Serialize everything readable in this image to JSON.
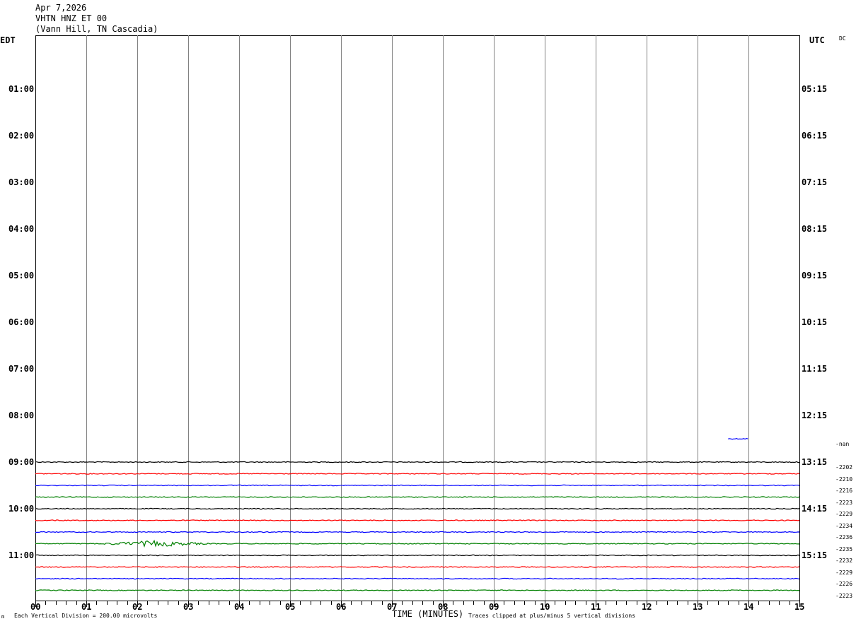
{
  "header": {
    "date": "Apr 7,2026",
    "station": "VHTN HNZ ET 00",
    "location": "(Vann Hill, TN Cascadia)"
  },
  "tz_left": "EDT",
  "tz_right": "UTC",
  "dc_label": "DC",
  "left_times": [
    "01:00",
    "02:00",
    "03:00",
    "04:00",
    "05:00",
    "06:00",
    "07:00",
    "08:00",
    "09:00",
    "10:00",
    "11:00"
  ],
  "right_times": [
    "05:15",
    "06:15",
    "07:15",
    "08:15",
    "09:15",
    "10:15",
    "11:15",
    "12:15",
    "13:15",
    "14:15",
    "15:15"
  ],
  "footer": {
    "division_note": "Each Vertical Division =  200.00 microvolts",
    "xlabel": "TIME (MINUTES)",
    "clip_note": "Traces clipped at plus/minus 5 vertical divisions",
    "corner_mark": "m"
  },
  "colors": {
    "black": "#000000",
    "red": "#ff0000",
    "blue": "#0000ff",
    "green": "#008000",
    "grid": "#808080"
  },
  "chart_data": {
    "type": "line",
    "title": "VHTN HNZ ET 00",
    "xlabel": "TIME (MINUTES)",
    "xlim": [
      0,
      15
    ],
    "x_ticks": [
      "00",
      "01",
      "02",
      "03",
      "04",
      "05",
      "06",
      "07",
      "08",
      "09",
      "10",
      "11",
      "12",
      "13",
      "14",
      "15"
    ],
    "y_axis": "hours, 15-minute traces per line",
    "traces": [
      {
        "start_edt": "08:30",
        "color": "blue",
        "dc_offset": "-nan",
        "span_min": [
          13.6,
          14.0
        ]
      },
      {
        "start_edt": "09:00",
        "color": "black",
        "dc_offset": "-2202"
      },
      {
        "start_edt": "09:15",
        "color": "red",
        "dc_offset": "-2210"
      },
      {
        "start_edt": "09:30",
        "color": "blue",
        "dc_offset": "-2216"
      },
      {
        "start_edt": "09:45",
        "color": "green",
        "dc_offset": "-2223"
      },
      {
        "start_edt": "10:00",
        "color": "black",
        "dc_offset": "-2229"
      },
      {
        "start_edt": "10:15",
        "color": "red",
        "dc_offset": "-2234"
      },
      {
        "start_edt": "10:30",
        "color": "blue",
        "dc_offset": "-2236"
      },
      {
        "start_edt": "10:45",
        "color": "green",
        "dc_offset": "-2235",
        "event_min": [
          1.3,
          3.4
        ]
      },
      {
        "start_edt": "11:00",
        "color": "black",
        "dc_offset": "-2232"
      },
      {
        "start_edt": "11:15",
        "color": "red",
        "dc_offset": "-2229"
      },
      {
        "start_edt": "11:30",
        "color": "blue",
        "dc_offset": "-2226"
      },
      {
        "start_edt": "11:45",
        "color": "green",
        "dc_offset": "-2223"
      }
    ]
  }
}
